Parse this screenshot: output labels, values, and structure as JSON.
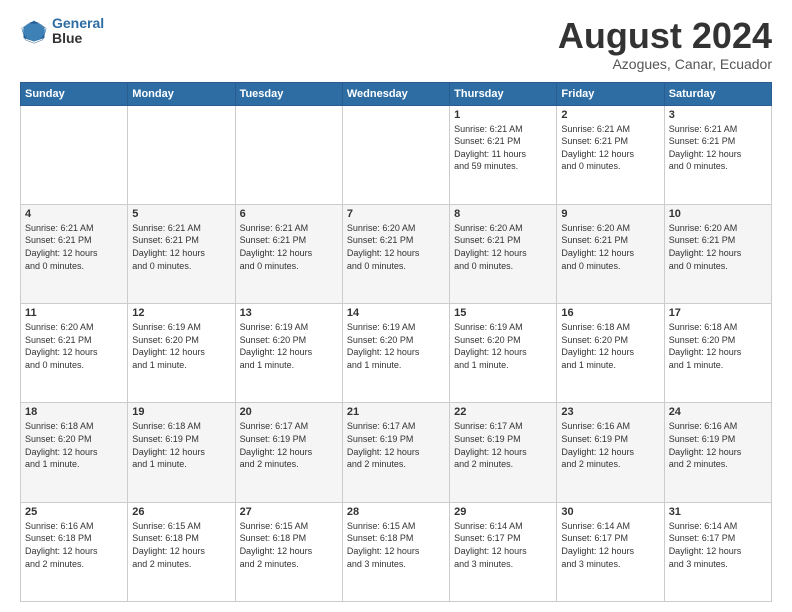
{
  "logo": {
    "line1": "General",
    "line2": "Blue"
  },
  "title": "August 2024",
  "subtitle": "Azogues, Canar, Ecuador",
  "days_of_week": [
    "Sunday",
    "Monday",
    "Tuesday",
    "Wednesday",
    "Thursday",
    "Friday",
    "Saturday"
  ],
  "weeks": [
    [
      {
        "day": "",
        "info": ""
      },
      {
        "day": "",
        "info": ""
      },
      {
        "day": "",
        "info": ""
      },
      {
        "day": "",
        "info": ""
      },
      {
        "day": "1",
        "info": "Sunrise: 6:21 AM\nSunset: 6:21 PM\nDaylight: 11 hours\nand 59 minutes."
      },
      {
        "day": "2",
        "info": "Sunrise: 6:21 AM\nSunset: 6:21 PM\nDaylight: 12 hours\nand 0 minutes."
      },
      {
        "day": "3",
        "info": "Sunrise: 6:21 AM\nSunset: 6:21 PM\nDaylight: 12 hours\nand 0 minutes."
      }
    ],
    [
      {
        "day": "4",
        "info": "Sunrise: 6:21 AM\nSunset: 6:21 PM\nDaylight: 12 hours\nand 0 minutes."
      },
      {
        "day": "5",
        "info": "Sunrise: 6:21 AM\nSunset: 6:21 PM\nDaylight: 12 hours\nand 0 minutes."
      },
      {
        "day": "6",
        "info": "Sunrise: 6:21 AM\nSunset: 6:21 PM\nDaylight: 12 hours\nand 0 minutes."
      },
      {
        "day": "7",
        "info": "Sunrise: 6:20 AM\nSunset: 6:21 PM\nDaylight: 12 hours\nand 0 minutes."
      },
      {
        "day": "8",
        "info": "Sunrise: 6:20 AM\nSunset: 6:21 PM\nDaylight: 12 hours\nand 0 minutes."
      },
      {
        "day": "9",
        "info": "Sunrise: 6:20 AM\nSunset: 6:21 PM\nDaylight: 12 hours\nand 0 minutes."
      },
      {
        "day": "10",
        "info": "Sunrise: 6:20 AM\nSunset: 6:21 PM\nDaylight: 12 hours\nand 0 minutes."
      }
    ],
    [
      {
        "day": "11",
        "info": "Sunrise: 6:20 AM\nSunset: 6:21 PM\nDaylight: 12 hours\nand 0 minutes."
      },
      {
        "day": "12",
        "info": "Sunrise: 6:19 AM\nSunset: 6:20 PM\nDaylight: 12 hours\nand 1 minute."
      },
      {
        "day": "13",
        "info": "Sunrise: 6:19 AM\nSunset: 6:20 PM\nDaylight: 12 hours\nand 1 minute."
      },
      {
        "day": "14",
        "info": "Sunrise: 6:19 AM\nSunset: 6:20 PM\nDaylight: 12 hours\nand 1 minute."
      },
      {
        "day": "15",
        "info": "Sunrise: 6:19 AM\nSunset: 6:20 PM\nDaylight: 12 hours\nand 1 minute."
      },
      {
        "day": "16",
        "info": "Sunrise: 6:18 AM\nSunset: 6:20 PM\nDaylight: 12 hours\nand 1 minute."
      },
      {
        "day": "17",
        "info": "Sunrise: 6:18 AM\nSunset: 6:20 PM\nDaylight: 12 hours\nand 1 minute."
      }
    ],
    [
      {
        "day": "18",
        "info": "Sunrise: 6:18 AM\nSunset: 6:20 PM\nDaylight: 12 hours\nand 1 minute."
      },
      {
        "day": "19",
        "info": "Sunrise: 6:18 AM\nSunset: 6:19 PM\nDaylight: 12 hours\nand 1 minute."
      },
      {
        "day": "20",
        "info": "Sunrise: 6:17 AM\nSunset: 6:19 PM\nDaylight: 12 hours\nand 2 minutes."
      },
      {
        "day": "21",
        "info": "Sunrise: 6:17 AM\nSunset: 6:19 PM\nDaylight: 12 hours\nand 2 minutes."
      },
      {
        "day": "22",
        "info": "Sunrise: 6:17 AM\nSunset: 6:19 PM\nDaylight: 12 hours\nand 2 minutes."
      },
      {
        "day": "23",
        "info": "Sunrise: 6:16 AM\nSunset: 6:19 PM\nDaylight: 12 hours\nand 2 minutes."
      },
      {
        "day": "24",
        "info": "Sunrise: 6:16 AM\nSunset: 6:19 PM\nDaylight: 12 hours\nand 2 minutes."
      }
    ],
    [
      {
        "day": "25",
        "info": "Sunrise: 6:16 AM\nSunset: 6:18 PM\nDaylight: 12 hours\nand 2 minutes."
      },
      {
        "day": "26",
        "info": "Sunrise: 6:15 AM\nSunset: 6:18 PM\nDaylight: 12 hours\nand 2 minutes."
      },
      {
        "day": "27",
        "info": "Sunrise: 6:15 AM\nSunset: 6:18 PM\nDaylight: 12 hours\nand 2 minutes."
      },
      {
        "day": "28",
        "info": "Sunrise: 6:15 AM\nSunset: 6:18 PM\nDaylight: 12 hours\nand 3 minutes."
      },
      {
        "day": "29",
        "info": "Sunrise: 6:14 AM\nSunset: 6:17 PM\nDaylight: 12 hours\nand 3 minutes."
      },
      {
        "day": "30",
        "info": "Sunrise: 6:14 AM\nSunset: 6:17 PM\nDaylight: 12 hours\nand 3 minutes."
      },
      {
        "day": "31",
        "info": "Sunrise: 6:14 AM\nSunset: 6:17 PM\nDaylight: 12 hours\nand 3 minutes."
      }
    ]
  ]
}
